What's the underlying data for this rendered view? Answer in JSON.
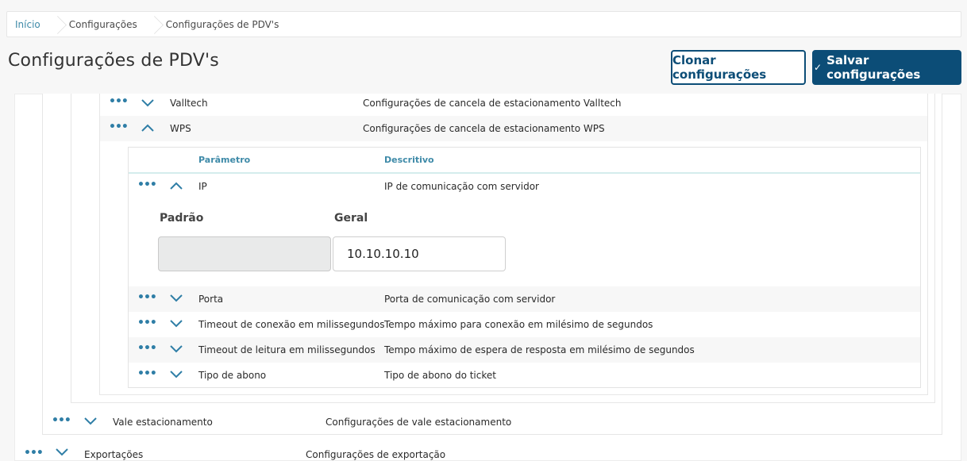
{
  "breadcrumb": {
    "items": [
      "Início",
      "Configurações",
      "Configurações de PDV's"
    ]
  },
  "page": {
    "title": "Configurações de PDV's",
    "clone_button": "Clonar configurações",
    "save_button": "Salvar configurações"
  },
  "colors": {
    "primary": "#0c4d77",
    "link": "#3e8aa8",
    "dots": "#2f7ea6"
  },
  "rows": {
    "valltech": {
      "name": "Valltech",
      "desc": "Configurações de cancela de estacionamento Valltech",
      "expanded": false
    },
    "wps": {
      "name": "WPS",
      "desc": "Configurações de cancela de estacionamento WPS",
      "expanded": true
    },
    "vale": {
      "name": "Vale estacionamento",
      "desc": "Configurações de vale estacionamento",
      "expanded": false
    },
    "exportacoes": {
      "name": "Exportações",
      "desc": "Configurações de exportação",
      "expanded": false
    }
  },
  "wps_table": {
    "header_param": "Parâmetro",
    "header_desc": "Descritivo",
    "ip": {
      "name": "IP",
      "desc": "IP de comunicação com servidor",
      "expanded": true
    },
    "ip_editor": {
      "default_label": "Padrão",
      "default_value": "",
      "general_label": "Geral",
      "general_value": "10.10.10.10"
    },
    "params": [
      {
        "name": "Porta",
        "desc": "Porta de comunicação com servidor"
      },
      {
        "name": "Timeout de conexão em milissegundos",
        "desc": "Tempo máximo para conexão em milésimo de segundos"
      },
      {
        "name": "Timeout de leitura em milissegundos",
        "desc": "Tempo máximo de espera de resposta em milésimo de segundos"
      },
      {
        "name": "Tipo de abono",
        "desc": "Tipo de abono do ticket"
      }
    ]
  },
  "icons": {
    "more": "more-dots-icon",
    "expand": "chevron-down-icon",
    "collapse": "chevron-up-icon",
    "check": "check-icon"
  }
}
